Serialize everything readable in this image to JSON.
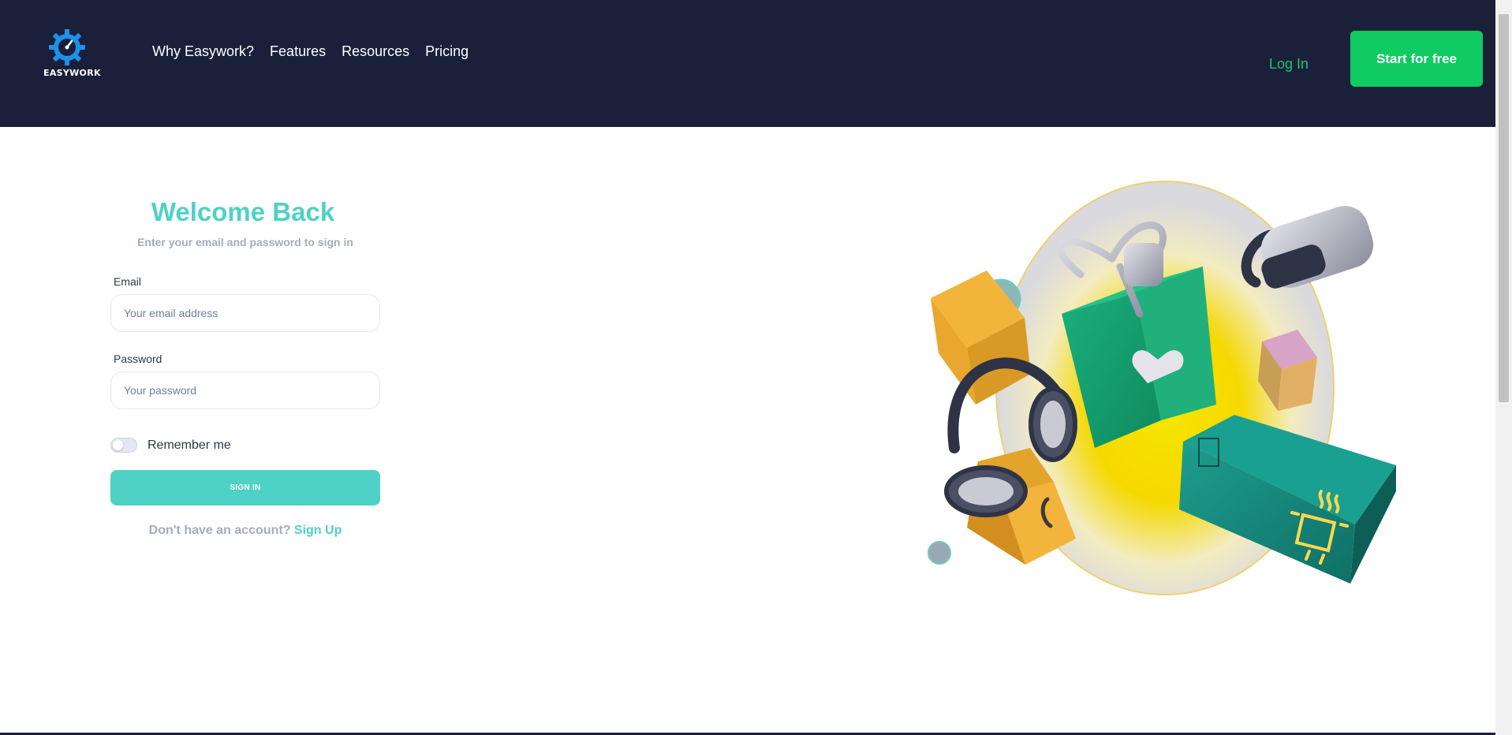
{
  "header": {
    "logo_text": "EASYWORK",
    "nav": [
      "Why Easywork?",
      "Features",
      "Resources",
      "Pricing"
    ],
    "login_label": "Log In",
    "cta_label": "Start for free"
  },
  "form": {
    "title": "Welcome Back",
    "subtitle": "Enter your email and password to sign in",
    "email_label": "Email",
    "email_placeholder": "Your email address",
    "password_label": "Password",
    "password_placeholder": "Your password",
    "remember_label": "Remember me",
    "remember_checked": false,
    "submit_label": "SIGN IN",
    "signup_prompt": "Don't have an account?",
    "signup_link": "Sign Up"
  },
  "colors": {
    "header_bg": "#1a1f3a",
    "accent_teal": "#4fd1c5",
    "cta_green": "#0fcb61",
    "login_green": "#1fc46b",
    "muted_text": "#a0aec0"
  }
}
